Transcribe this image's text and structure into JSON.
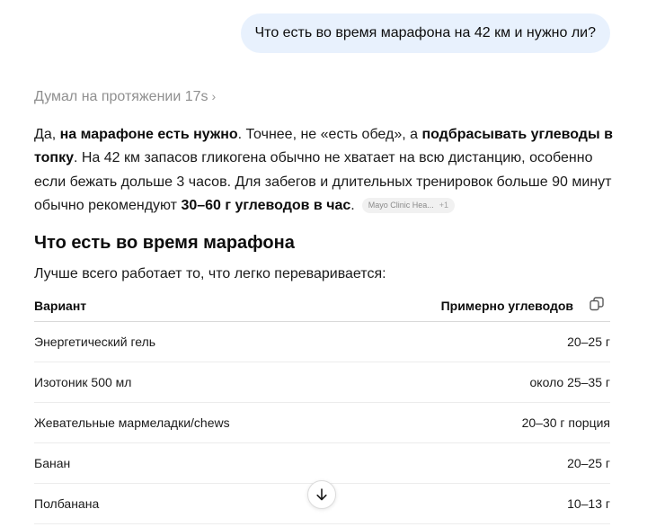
{
  "user_message": "Что есть во время марафона на 42 км и нужно ли?",
  "thought": {
    "label": "Думал на протяжении 17s",
    "chevron": "›"
  },
  "answer": {
    "p1": "Да, ",
    "b1": "на марафоне есть нужно",
    "p2": ". Точнее, не «есть обед», а ",
    "b2": "подбрасывать углеводы в топку",
    "p3": ". На 42 км запасов гликогена обычно не хватает на всю дистанцию, особенно если бежать дольше 3 часов. Для забегов и длительных тренировок больше 90 минут обычно рекомендуют ",
    "b3": "30–60 г углеводов в час",
    "p4": ".",
    "citation": "Mayo Clinic Hea...",
    "citation_extra": "+1"
  },
  "section": {
    "heading": "Что есть во время марафона",
    "intro": "Лучше всего работает то, что легко переваривается:"
  },
  "table": {
    "headers": [
      "Вариант",
      "Примерно углеводов"
    ],
    "rows": [
      [
        "Энергетический гель",
        "20–25 г"
      ],
      [
        "Изотоник 500 мл",
        "около 25–35 г"
      ],
      [
        "Жевательные мармеладки/chews",
        "20–30 г порция"
      ],
      [
        "Банан",
        "20–25 г"
      ],
      [
        "Полбанана",
        "10–13 г"
      ]
    ]
  },
  "icons": {
    "copy": "copy-icon",
    "scroll_down": "arrow-down-icon"
  }
}
